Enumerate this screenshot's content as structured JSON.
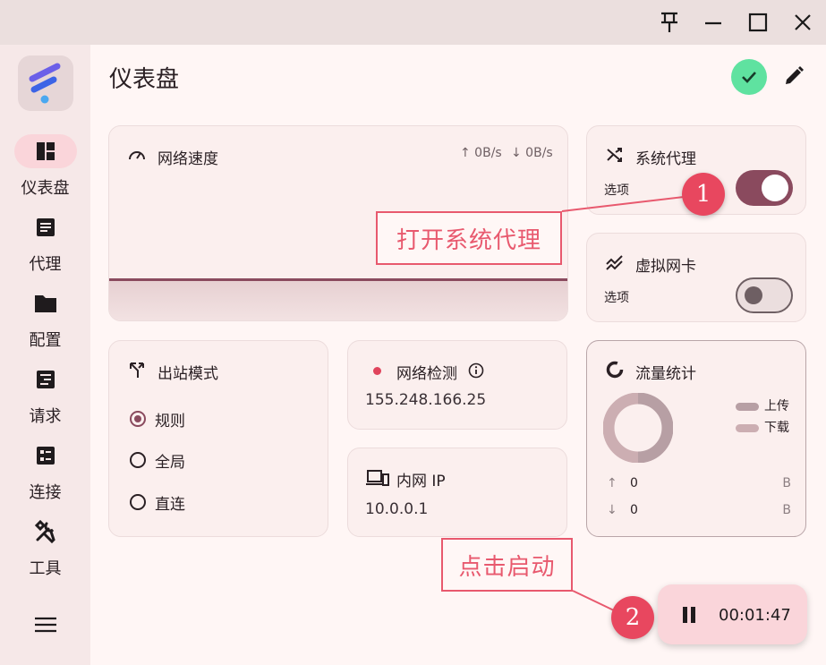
{
  "window": {
    "buttons": [
      {
        "name": "pin",
        "icon": "pin-icon"
      },
      {
        "name": "minimize",
        "icon": "minimize-icon"
      },
      {
        "name": "maximize",
        "icon": "maximize-icon"
      },
      {
        "name": "close",
        "icon": "close-icon"
      }
    ]
  },
  "sidebar": {
    "logo_icon": "app-logo-icon",
    "items": [
      {
        "label": "仪表盘",
        "icon": "dashboard-icon",
        "active": true
      },
      {
        "label": "代理",
        "icon": "proxy-list-icon",
        "active": false
      },
      {
        "label": "配置",
        "icon": "folder-icon",
        "active": false
      },
      {
        "label": "请求",
        "icon": "requests-icon",
        "active": false
      },
      {
        "label": "连接",
        "icon": "connections-icon",
        "active": false
      },
      {
        "label": "工具",
        "icon": "tools-icon",
        "active": false
      }
    ],
    "menu_icon": "menu-icon"
  },
  "header": {
    "title": "仪表盘",
    "status_icon": "check-icon",
    "edit_icon": "edit-icon"
  },
  "network_speed": {
    "title": "网络速度",
    "icon": "speedometer-icon",
    "upload": "↑ 0B/s",
    "download": "↓ 0B/s"
  },
  "system_proxy": {
    "title": "系统代理",
    "icon": "shuffle-icon",
    "options_label": "选项",
    "enabled": true
  },
  "virtual_nic": {
    "title": "虚拟网卡",
    "icon": "trend-icon",
    "options_label": "选项",
    "enabled": false
  },
  "outbound_mode": {
    "title": "出站模式",
    "icon": "route-icon",
    "options": [
      {
        "label": "规则",
        "selected": true
      },
      {
        "label": "全局",
        "selected": false
      },
      {
        "label": "直连",
        "selected": false
      }
    ]
  },
  "network_check": {
    "title": "网络检测",
    "value": "155.248.166.25",
    "status_color": "#e0445c",
    "info_icon": "info-icon"
  },
  "intranet_ip": {
    "title": "内网 IP",
    "icon": "devices-icon",
    "value": "10.0.0.1"
  },
  "traffic_stats": {
    "title": "流量统计",
    "icon": "donut-icon",
    "legend": [
      {
        "label": "上传",
        "color": "#b79fa4"
      },
      {
        "label": "下载",
        "color": "#ccaeb2"
      }
    ],
    "rows": [
      {
        "arrow": "↑",
        "value": "0",
        "unit": "B"
      },
      {
        "arrow": "↓",
        "value": "0",
        "unit": "B"
      }
    ]
  },
  "annotations": {
    "callout_1": "打开系统代理",
    "marker_1": "1",
    "callout_2": "点击启动",
    "marker_2": "2"
  },
  "fab": {
    "icon": "pause-icon",
    "timer": "00:01:47"
  },
  "colors": {
    "accent": "#8a4a5e",
    "success": "#5fe2a0",
    "annotation": "#e8475f"
  }
}
